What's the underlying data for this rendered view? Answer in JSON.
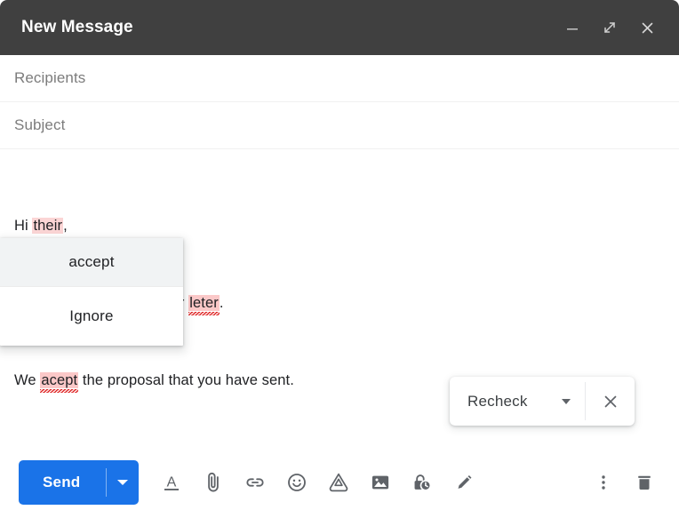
{
  "window": {
    "title": "New Message",
    "controls": [
      {
        "name": "minimize-button",
        "icon": "minimize-icon"
      },
      {
        "name": "expand-button",
        "icon": "expand-icon"
      },
      {
        "name": "close-button",
        "icon": "close-icon"
      }
    ]
  },
  "fields": {
    "recipients_placeholder": "Recipients",
    "subject_placeholder": "Subject",
    "recipients_value": "",
    "subject_value": ""
  },
  "body": {
    "line1_pre": "Hi ",
    "line1_mark": "their",
    "line1_post": ",",
    "line2_pre": "This is a response to your ",
    "line2_mark": "leter",
    "line2_post": ".",
    "line3_pre": "We ",
    "line3_mark": "acept",
    "line3_post": " the proposal that you have sent."
  },
  "suggestion_popup": {
    "items": [
      {
        "label": "accept",
        "state": "highlighted"
      },
      {
        "label": "Ignore",
        "state": "normal"
      }
    ]
  },
  "recheck": {
    "label": "Recheck",
    "dropdown_icon": "chevron-down-icon",
    "close_icon": "close-icon"
  },
  "toolbar": {
    "send_label": "Send",
    "send_dropdown_icon": "chevron-down-icon",
    "icons": [
      {
        "name": "format-text-icon",
        "title": "Formatting options"
      },
      {
        "name": "attach-file-icon",
        "title": "Attach files"
      },
      {
        "name": "insert-link-icon",
        "title": "Insert link"
      },
      {
        "name": "insert-emoji-icon",
        "title": "Insert emoji"
      },
      {
        "name": "google-drive-icon",
        "title": "Insert files using Drive"
      },
      {
        "name": "insert-photo-icon",
        "title": "Insert photo"
      },
      {
        "name": "confidential-mode-icon",
        "title": "Toggle confidential mode"
      },
      {
        "name": "insert-signature-icon",
        "title": "Insert signature"
      }
    ],
    "right_icons": [
      {
        "name": "more-options-icon",
        "title": "More options"
      },
      {
        "name": "discard-draft-icon",
        "title": "Discard draft"
      }
    ]
  },
  "colors": {
    "titlebar_bg": "#404040",
    "send_blue": "#1a73e8",
    "spell_highlight": "#fbc8c8",
    "grammar_highlight": "#fbd5d5",
    "squiggle_red": "#e02b2b",
    "icon_gray": "#5f6368"
  }
}
